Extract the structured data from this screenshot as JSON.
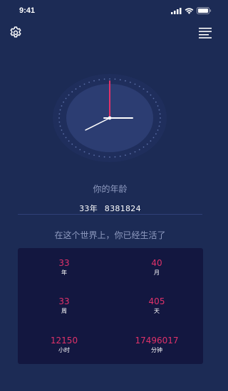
{
  "status_bar": {
    "time": "9:41"
  },
  "nav": {
    "settings_icon": "gear-icon",
    "menu_icon": "menu-lines-icon"
  },
  "clock": {
    "hour_hand_angle_deg": 90,
    "minute_hand_angle_deg": 0,
    "second_hand_angle_deg": 238,
    "colors": {
      "face": "#2c3d72",
      "ring": "#1f2e5c",
      "hour_minute_hand": "#ffffff",
      "second_hand": "#e0326a",
      "tick_dots": "#5b6ea6"
    }
  },
  "age": {
    "label": "你的年龄",
    "years": "33年",
    "number": "8381824"
  },
  "lived": {
    "label": "在这个世界上，你已经生活了"
  },
  "stats": [
    {
      "value": "33",
      "unit": "年"
    },
    {
      "value": "40",
      "unit": "月"
    },
    {
      "value": "33",
      "unit": "周"
    },
    {
      "value": "405",
      "unit": "天"
    },
    {
      "value": "12150",
      "unit": "小时"
    },
    {
      "value": "17496017",
      "unit": "分钟"
    }
  ],
  "colors": {
    "background": "#1c2b55",
    "panel": "#131740",
    "accent": "#e0326a",
    "muted_text": "#8f9bc0"
  }
}
